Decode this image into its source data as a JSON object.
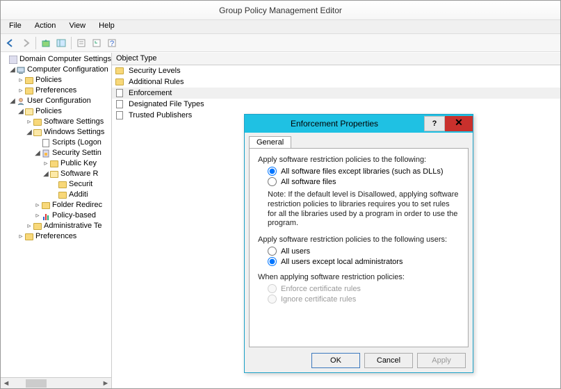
{
  "window": {
    "title": "Group Policy Management Editor"
  },
  "menu": {
    "file": "File",
    "action": "Action",
    "view": "View",
    "help": "Help"
  },
  "toolbar_icons": [
    "back",
    "forward",
    "up",
    "window",
    "grid",
    "doc",
    "refresh",
    "help2"
  ],
  "tree": {
    "root": "Domain Computer Settings",
    "comp_conf": "Computer Configuration",
    "comp_policies": "Policies",
    "comp_prefs": "Preferences",
    "user_conf": "User Configuration",
    "user_policies": "Policies",
    "sw_settings": "Software Settings",
    "win_settings": "Windows Settings",
    "scripts": "Scripts (Logon",
    "sec_settings": "Security Settin",
    "public_key": "Public Key",
    "software_r": "Software R",
    "securit": "Securit",
    "additi": "Additi",
    "folder_redir": "Folder Redirec",
    "policy_based": "Policy-based",
    "admin_te": "Administrative Te",
    "user_prefs": "Preferences"
  },
  "list": {
    "header": "Object Type",
    "items": [
      {
        "icon": "folder",
        "label": "Security Levels"
      },
      {
        "icon": "folder",
        "label": "Additional Rules"
      },
      {
        "icon": "doc",
        "label": "Enforcement",
        "selected": true
      },
      {
        "icon": "doc",
        "label": "Designated File Types"
      },
      {
        "icon": "doc",
        "label": "Trusted Publishers"
      }
    ]
  },
  "dialog": {
    "title": "Enforcement Properties",
    "help": "?",
    "close": "✕",
    "tab": "General",
    "section1": "Apply software restriction policies to the following:",
    "r1a": "All software files except libraries (such as DLLs)",
    "r1b": "All software files",
    "note": "Note:  If the default level is Disallowed, applying software restriction policies to libraries requires you to set rules for all the libraries used by a program in order to use the program.",
    "section2": "Apply software restriction policies to the following users:",
    "r2a": "All users",
    "r2b": "All users except local administrators",
    "section3": "When applying software restriction policies:",
    "r3a": "Enforce certificate rules",
    "r3b": "Ignore certificate rules",
    "ok": "OK",
    "cancel": "Cancel",
    "apply": "Apply"
  }
}
